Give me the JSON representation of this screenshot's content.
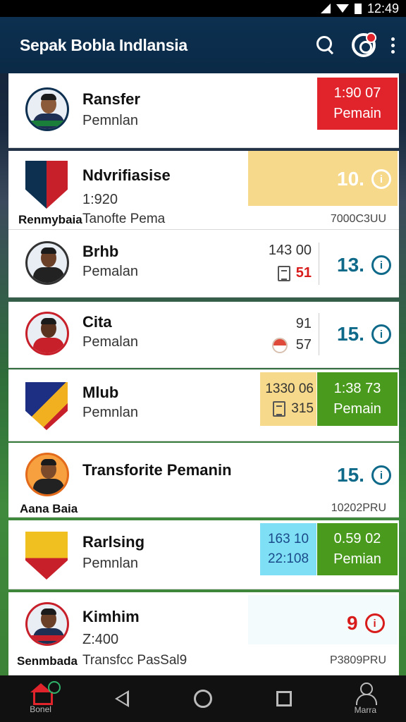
{
  "status_bar": {
    "time": "12:49"
  },
  "app_bar": {
    "title": "Sepak Bobla Indlansia"
  },
  "rows": [
    {
      "title": "Ransfer",
      "subtitle": "Pemnlan",
      "box_line1": "1:90 07",
      "box_line2": "Pemain",
      "box_color": "#e1242c"
    },
    {
      "title": "Ndvrifiasise",
      "subtitle": "1:920",
      "caption": "Renmybaia",
      "subcaption": "Tanofte Pema",
      "num": "10.",
      "ref": "7000C3UU",
      "box_color": "#f6d98a"
    },
    {
      "title": "Brhb",
      "subtitle": "Pemalan",
      "stat_top": "143 00",
      "stat_bottom": "51",
      "num": "13."
    },
    {
      "title": "Cita",
      "subtitle": "Pemalan",
      "stat_top": "91",
      "stat_bottom": "57",
      "num": "15."
    },
    {
      "title": "Mlub",
      "subtitle": "Pemnlan",
      "yellow_top": "1330 06",
      "yellow_bottom": "315",
      "green_top": "1:38 73",
      "green_bottom": "Pemain"
    },
    {
      "title": "Transforite Pemanin",
      "caption": "Aana Baia",
      "num": "15.",
      "ref": "10202PRU"
    },
    {
      "title": "Rarlsing",
      "subtitle": "Pemnlan",
      "blue_top": "163 10",
      "blue_bottom": "22:108",
      "green_top": "0.59 02",
      "green_bottom": "Pemian"
    },
    {
      "title": "Kimhim",
      "subtitle": "Z:400",
      "caption": "Senmbada",
      "subcaption": "Transfcc PasSal9",
      "num": "9",
      "ref": "P3809PRU"
    }
  ],
  "nav": {
    "home_label": "Bonel",
    "profile_label": "Marra"
  },
  "icons": {
    "search": "search-icon",
    "logo": "club-logo-icon",
    "more": "more-vert-icon",
    "info": "info-icon",
    "home": "home-icon",
    "back": "back-icon",
    "recents": "recents-icon",
    "circle": "home-circle-icon",
    "profile": "person-icon"
  },
  "colors": {
    "appbar": "#0a2a47",
    "red": "#e1242c",
    "green": "#4a9a1e",
    "yellow": "#f6d98a",
    "cyan": "#7fe0f5",
    "teal": "#0f6a8a"
  }
}
